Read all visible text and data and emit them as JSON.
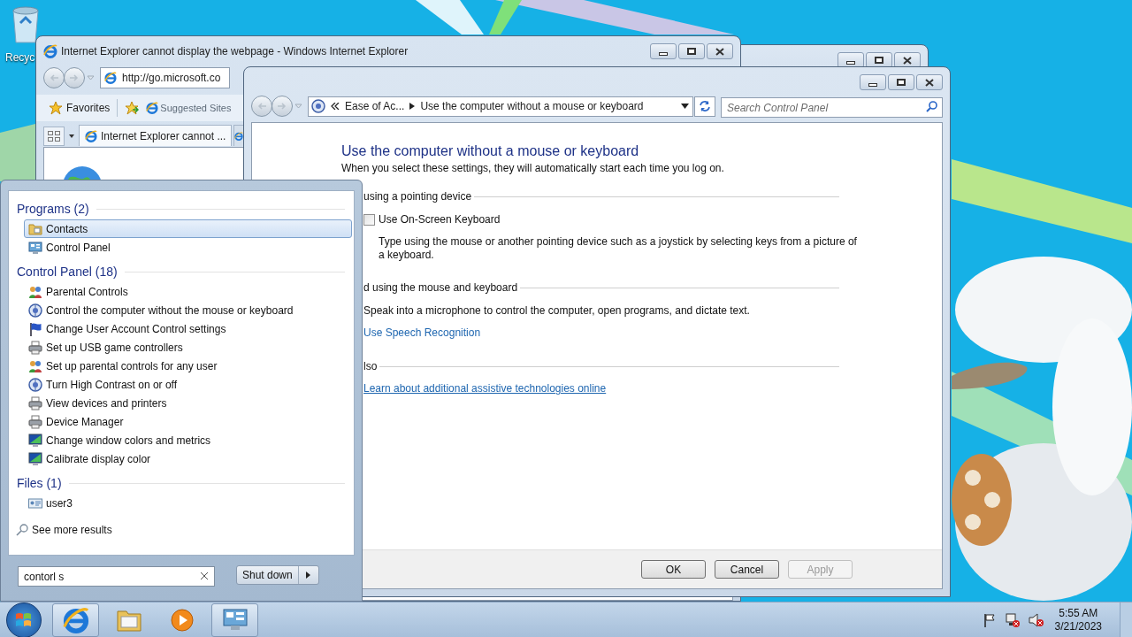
{
  "desktop": {
    "icons": [
      {
        "label": "Recyc"
      }
    ]
  },
  "ie_window": {
    "title": "Internet Explorer cannot display the webpage - Windows Internet Explorer",
    "address": "http://go.microsoft.co",
    "favorites": "Favorites",
    "suggested_sites": "Suggested Sites",
    "tabs": [
      {
        "label": "Internet Explorer cannot ...",
        "selected": true
      }
    ]
  },
  "control_panel": {
    "breadcrumb": [
      "Ease of Ac...",
      "Use the computer without a mouse or keyboard"
    ],
    "search_placeholder": "Search Control Panel",
    "heading": "Use the computer without a mouse or keyboard",
    "intro": "When you select these settings, they will automatically start each time you log on.",
    "sections": [
      {
        "title": "using a pointing device",
        "items": [
          {
            "kind": "checkbox",
            "label": "Use On-Screen Keyboard",
            "checked": false,
            "description": "Type using the mouse or another pointing device such as a joystick by selecting keys from a picture of a keyboard."
          }
        ]
      },
      {
        "title": "d using the mouse and keyboard",
        "items": [
          {
            "kind": "text",
            "text": "Speak into a microphone to control the computer, open programs, and dictate text."
          },
          {
            "kind": "link",
            "label": "Use Speech Recognition",
            "underlined": false
          }
        ]
      },
      {
        "title": "lso",
        "items": [
          {
            "kind": "link",
            "label": "Learn about additional assistive technologies online",
            "underlined": true
          }
        ]
      }
    ],
    "buttons": [
      {
        "label": "OK",
        "disabled": false
      },
      {
        "label": "Cancel",
        "disabled": false
      },
      {
        "label": "Apply",
        "disabled": true
      }
    ]
  },
  "start_menu": {
    "groups": [
      {
        "title": "Programs (2)",
        "items": [
          {
            "kind": "folder",
            "label": "Contacts",
            "selected": true
          },
          {
            "kind": "panel",
            "label": "Control Panel",
            "selected": false
          }
        ]
      },
      {
        "title": "Control Panel (18)",
        "items": [
          {
            "kind": "people",
            "label": "Parental Controls",
            "selected": false
          },
          {
            "kind": "dial",
            "label": "Control the computer without the mouse or keyboard",
            "selected": false
          },
          {
            "kind": "flag",
            "label": "Change User Account Control settings",
            "selected": false
          },
          {
            "kind": "printer",
            "label": "Set up USB game controllers",
            "selected": false
          },
          {
            "kind": "people",
            "label": "Set up parental controls for any user",
            "selected": false
          },
          {
            "kind": "dial",
            "label": "Turn High Contrast on or off",
            "selected": false
          },
          {
            "kind": "printer",
            "label": "View devices and printers",
            "selected": false
          },
          {
            "kind": "printer",
            "label": "Device Manager",
            "selected": false
          },
          {
            "kind": "monitor",
            "label": "Change window colors and metrics",
            "selected": false
          },
          {
            "kind": "monitor",
            "label": "Calibrate display color",
            "selected": false
          }
        ]
      },
      {
        "title": "Files (1)",
        "items": [
          {
            "kind": "file",
            "label": "user3",
            "selected": false
          }
        ]
      }
    ],
    "see_more": "See more results",
    "search_value": "contorl s",
    "shutdown": "Shut down"
  },
  "taskbar": {
    "apps": [
      {
        "kind": "browser",
        "open": true
      },
      {
        "kind": "folder",
        "open": false
      },
      {
        "kind": "media",
        "open": false
      },
      {
        "kind": "panel",
        "open": true
      }
    ],
    "clock": {
      "time": "5:55 AM",
      "date": "3/21/2023"
    }
  }
}
